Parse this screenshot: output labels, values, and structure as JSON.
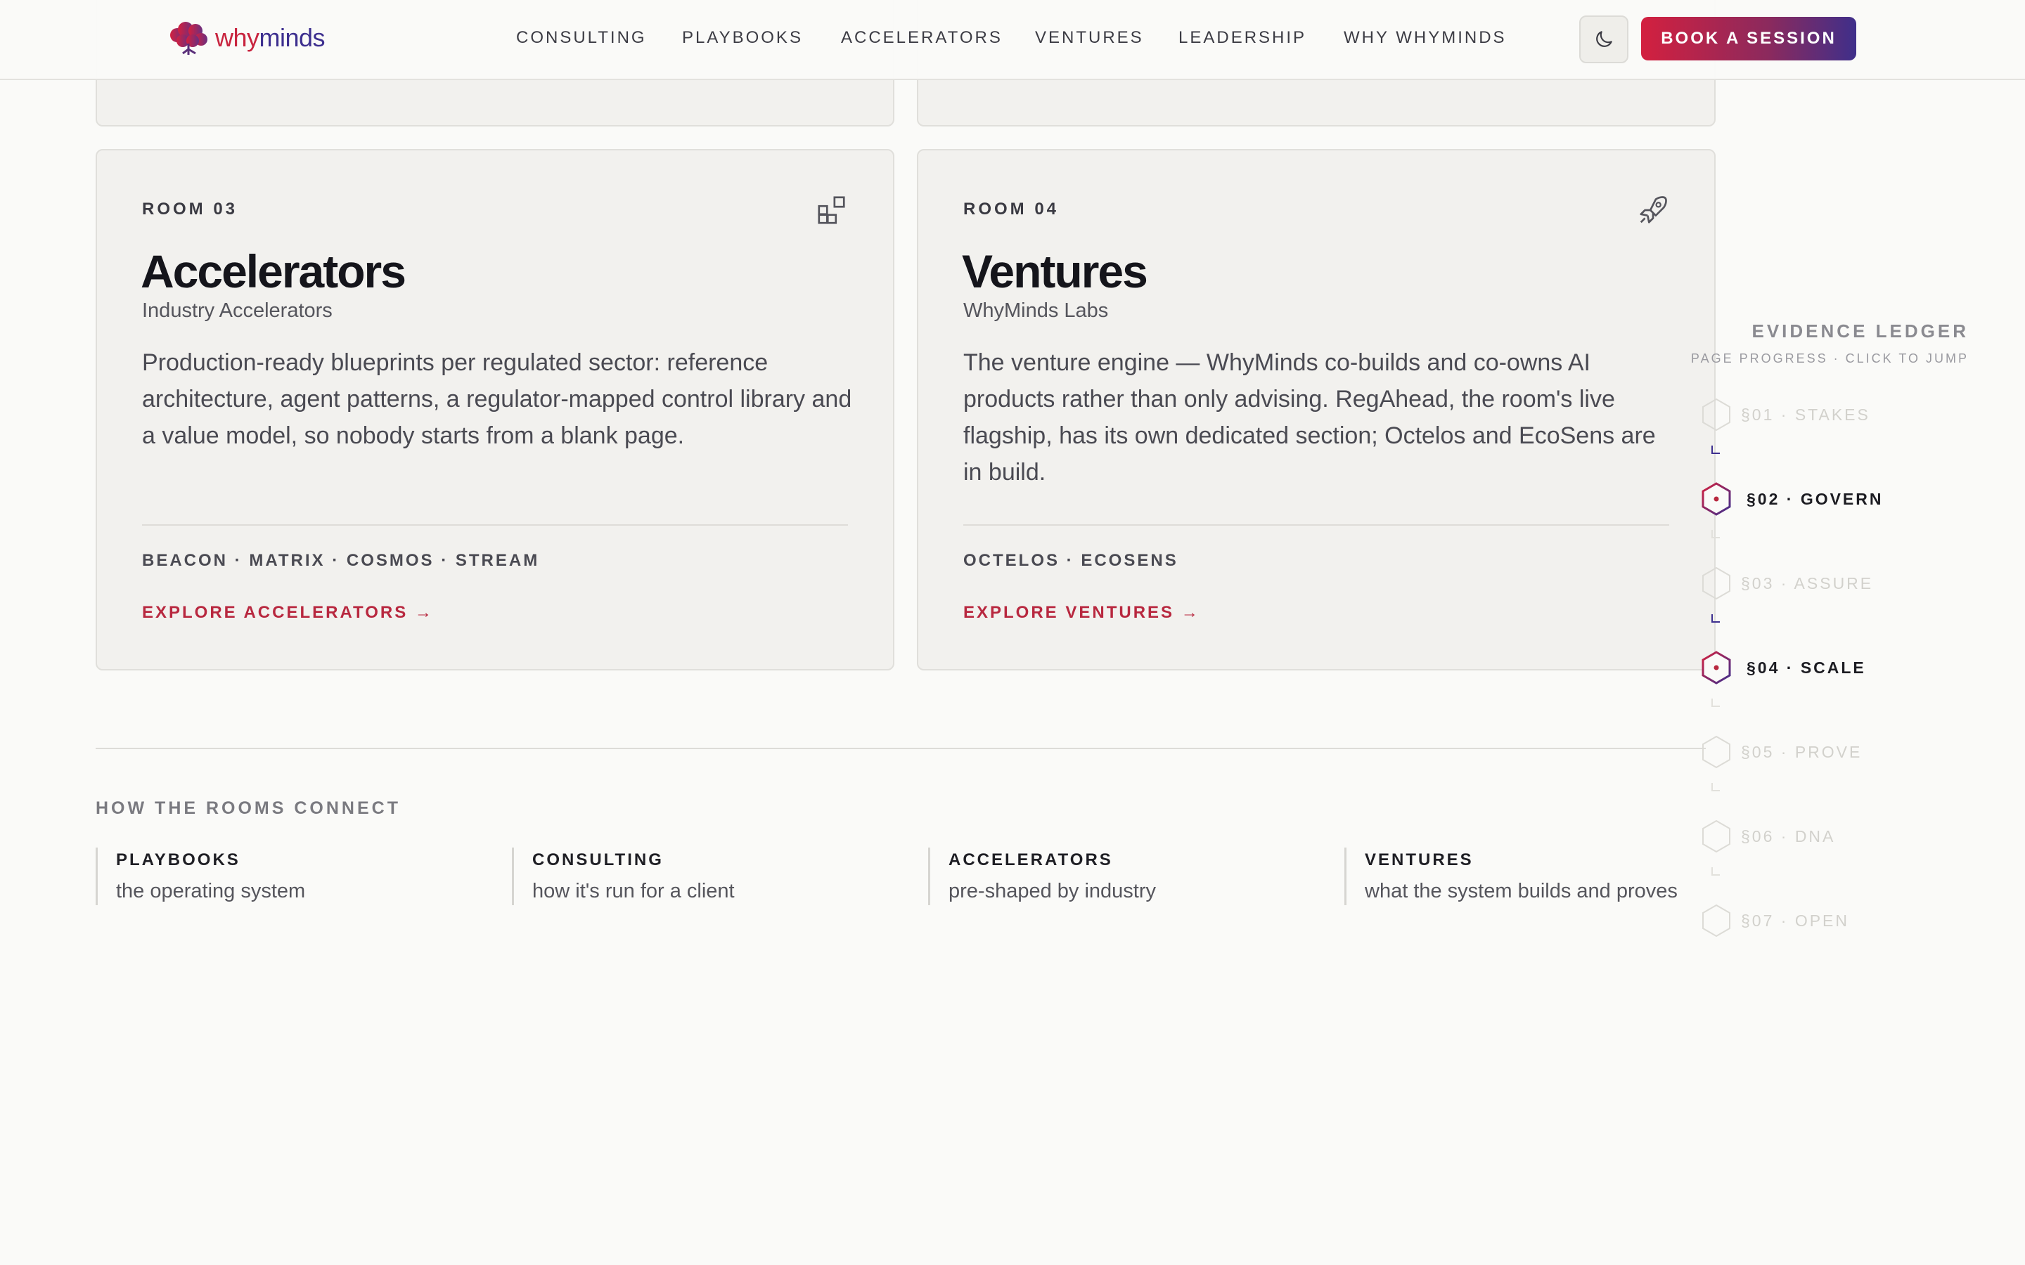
{
  "header": {
    "logo": {
      "why": "why",
      "minds": "minds"
    },
    "nav": [
      "CONSULTING",
      "PLAYBOOKS",
      "ACCELERATORS",
      "VENTURES",
      "LEADERSHIP",
      "WHY WHYMINDS"
    ],
    "theme_icon": "moon-icon",
    "cta": "BOOK A SESSION"
  },
  "rooms": [
    {
      "label": "ROOM 03",
      "icon": "blocks-icon",
      "title": "Accelerators",
      "subtitle": "Industry Accelerators",
      "description": "Production-ready blueprints per regulated sector: reference architecture, agent patterns, a regulator-mapped control library and a value model, so nobody starts from a blank page.",
      "tags": "BEACON · MATRIX · COSMOS · STREAM",
      "link": "EXPLORE ACCELERATORS →"
    },
    {
      "label": "ROOM 04",
      "icon": "rocket-icon",
      "title": "Ventures",
      "subtitle": "WhyMinds Labs",
      "description": "The venture engine — WhyMinds co-builds and co-owns AI products rather than only advising. RegAhead, the room's live flagship, has its own dedicated section; Octelos and EcoSens are in build.",
      "tags": "OCTELOS · ECOSENS",
      "link": "EXPLORE VENTURES →"
    }
  ],
  "connect": {
    "title": "HOW THE ROOMS CONNECT",
    "items": [
      {
        "head": "PLAYBOOKS",
        "text": "the operating system"
      },
      {
        "head": "CONSULTING",
        "text": "how it's run for a client"
      },
      {
        "head": "ACCELERATORS",
        "text": "pre-shaped by industry"
      },
      {
        "head": "VENTURES",
        "text": "what the system builds and proves"
      }
    ]
  },
  "ledger": {
    "title": "EVIDENCE LEDGER",
    "subtitle": "PAGE PROGRESS · CLICK TO JUMP",
    "items": [
      {
        "label": "§01 · STAKES",
        "state": "dim"
      },
      {
        "label": "§02 · GOVERN",
        "state": "active"
      },
      {
        "label": "§03 · ASSURE",
        "state": "dim"
      },
      {
        "label": "§04 · SCALE",
        "state": "active"
      },
      {
        "label": "§05 · PROVE",
        "state": "dim"
      },
      {
        "label": "§06 · DNA",
        "state": "dim"
      },
      {
        "label": "§07 · OPEN",
        "state": "dim"
      }
    ]
  },
  "colors": {
    "brand_red": "#c8243f",
    "brand_purple": "#3d2f8f",
    "link_red": "#b8283f"
  }
}
